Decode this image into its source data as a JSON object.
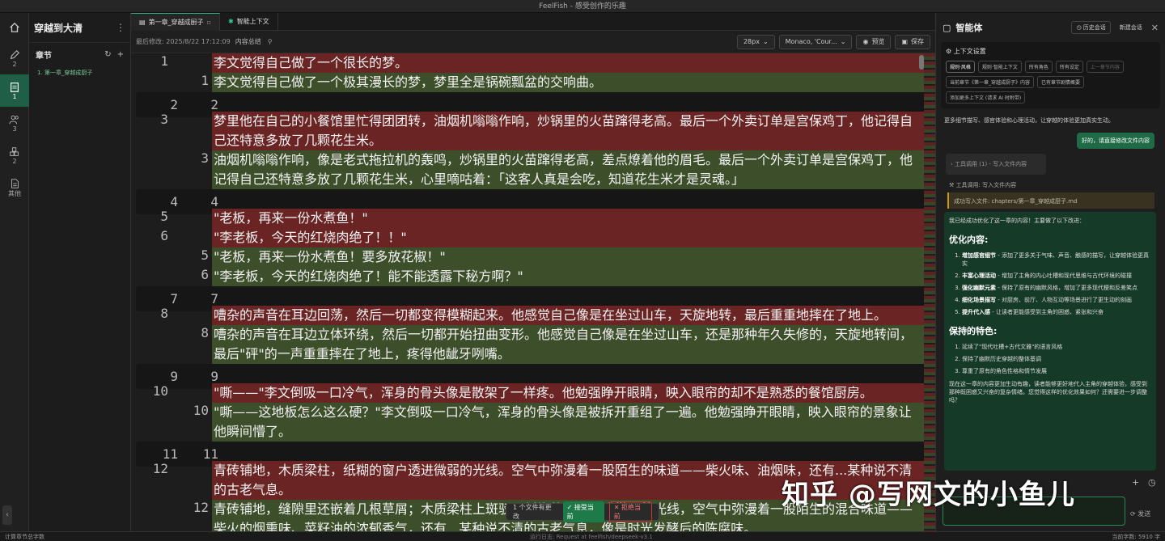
{
  "window_title": "FeelFish - 感受创作的乐趣",
  "sidebar": {
    "project_title": "穿越到大清",
    "section_title": "章节",
    "chapter_item": "1. 第一章_穿越成厨子"
  },
  "activity": [
    {
      "icon": "pen-icon",
      "badge": "2"
    },
    {
      "icon": "document-icon",
      "badge": "1"
    },
    {
      "icon": "people-icon",
      "badge": "3"
    },
    {
      "icon": "blocks-icon",
      "badge": "2"
    },
    {
      "icon": "file-icon",
      "badge": "其他"
    }
  ],
  "tabs": [
    {
      "label": "第一章_穿越成厨子"
    },
    {
      "label": "智能上下文"
    }
  ],
  "toolbar": {
    "modified": "最后修改: 2025/8/22 17:12:09",
    "summary": "内容总结",
    "font_size": "28px",
    "font_family": "Monaco, 'Cour...",
    "preview": "预览",
    "save": "保存"
  },
  "diff_lines": [
    {
      "type": "del",
      "ln1": "1",
      "ln2": "",
      "text": "李文觉得自己做了一个很长的梦。"
    },
    {
      "type": "add",
      "ln1": "",
      "ln2": "1",
      "text": "李文觉得自己做了一个极其漫长的梦，梦里全是锅碗瓢盆的交响曲。"
    },
    {
      "type": "ctx",
      "ln1": "2",
      "ln2": "2",
      "text": ""
    },
    {
      "type": "del",
      "ln1": "3",
      "ln2": "",
      "text": "梦里他在自己的小餐馆里忙得团团转，油烟机嗡嗡作响，炒锅里的火苗蹿得老高。最后一个外卖订单是宫保鸡丁，他记得自己还特意多放了几颗花生米。"
    },
    {
      "type": "add",
      "ln1": "",
      "ln2": "3",
      "text": "油烟机嗡嗡作响，像是老式拖拉机的轰鸣，炒锅里的火苗蹿得老高，差点燎着他的眉毛。最后一个外卖订单是宫保鸡丁，他记得自己还特意多放了几颗花生米，心里嘀咕着：「这客人真是会吃，知道花生米才是灵魂。」"
    },
    {
      "type": "ctx",
      "ln1": "4",
      "ln2": "4",
      "text": ""
    },
    {
      "type": "del",
      "ln1": "5",
      "ln2": "",
      "text": "\"老板，再来一份水煮鱼！\""
    },
    {
      "type": "del",
      "ln1": "6",
      "ln2": "",
      "text": "\"李老板，今天的红烧肉绝了！！\""
    },
    {
      "type": "add",
      "ln1": "",
      "ln2": "5",
      "text": "\"老板，再来一份水煮鱼！要多放花椒！\""
    },
    {
      "type": "add",
      "ln1": "",
      "ln2": "6",
      "text": "\"李老板，今天的红烧肉绝了！能不能透露下秘方啊？\""
    },
    {
      "type": "ctx",
      "ln1": "7",
      "ln2": "7",
      "text": ""
    },
    {
      "type": "del",
      "ln1": "8",
      "ln2": "",
      "text": "嘈杂的声音在耳边回荡，然后一切都变得模糊起来。他感觉自己像是在坐过山车，天旋地转，最后重重地摔在了地上。"
    },
    {
      "type": "add",
      "ln1": "",
      "ln2": "8",
      "text": "嘈杂的声音在耳边立体环绕，然后一切都开始扭曲变形。他感觉自己像是在坐过山车，还是那种年久失修的，天旋地转间，最后\"砰\"的一声重重摔在了地上，疼得他龇牙咧嘴。"
    },
    {
      "type": "ctx",
      "ln1": "9",
      "ln2": "9",
      "text": ""
    },
    {
      "type": "del",
      "ln1": "10",
      "ln2": "",
      "text": "\"嘶——\"李文倒吸一口冷气，浑身的骨头像是散架了一样疼。他勉强睁开眼睛，映入眼帘的却不是熟悉的餐馆厨房。"
    },
    {
      "type": "add",
      "ln1": "",
      "ln2": "10",
      "text": "\"嘶——这地板怎么这么硬？\"李文倒吸一口冷气，浑身的骨头像是被拆开重组了一遍。他勉强睁开眼睛，映入眼帘的景象让他瞬间懵了。"
    },
    {
      "type": "ctx",
      "ln1": "11",
      "ln2": "11",
      "text": ""
    },
    {
      "type": "del",
      "ln1": "12",
      "ln2": "",
      "text": "青砖铺地，木质梁柱，纸糊的窗户透进微弱的光线。空气中弥漫着一股陌生的味道——柴火味、油烟味，还有...某种说不清的古老气息。"
    },
    {
      "type": "add",
      "ln1": "",
      "ln2": "12",
      "text": "青砖铺地，缝隙里还嵌着几根草屑；木质梁柱上斑驳，纸糊的窗户透进微弱的光线，空气中弥漫着一股陌生的混合味道——柴火的烟熏味、菜籽油的浓郁香气，还有...某种说不清的古老气息，像是时光发酵后的陈腐味。"
    }
  ],
  "diff_bar": {
    "count": "1 个文件有更改",
    "accept": "接受当前",
    "reject": "拒绝当前"
  },
  "agent": {
    "title": "智能体",
    "history": "历史会话",
    "new_chat": "新建会话",
    "ctx_title": "上下文设置",
    "chips": [
      {
        "label": "规则·风格",
        "state": "on"
      },
      {
        "label": "规则·智能上下文",
        "state": "normal"
      },
      {
        "label": "所有角色",
        "state": "normal"
      },
      {
        "label": "所有设定",
        "state": "normal"
      },
      {
        "label": "上一章节内容",
        "state": "dim"
      },
      {
        "label": "当前章节《第一章_穿越成厨子》内容",
        "state": "normal"
      },
      {
        "label": "已有章节剧情概要",
        "state": "normal"
      },
      {
        "label": "添加更多上下文 (请求 AI 时附带)",
        "state": "normal"
      }
    ],
    "sys_msg": "更多细节描写、感官体验和心理活动，让穿越的体验更加真实生动。",
    "user_msg": "好的，请直接修改文件内容",
    "tool_card": "工具调用 (1)  - 写入文件内容",
    "tool_line": "工具调用: 写入文件内容",
    "tool_file": "成功写入文件: chapters/第一章_穿越成厨子.md",
    "answer_intro": "我已经成功优化了这一章的内容！主要做了以下改进：",
    "h_opt": "优化内容:",
    "opt_items": [
      {
        "b": "增加感官细节",
        "t": " - 添加了更多关于气味、声音、触感的描写，让穿越体验更真实"
      },
      {
        "b": "丰富心理活动",
        "t": " - 增加了主角的内心吐槽和现代思维与古代环境的碰撞"
      },
      {
        "b": "强化幽默元素",
        "t": " - 保持了原有的幽默风格，增加了更多现代梗和反差笑点"
      },
      {
        "b": "细化场景描写",
        "t": " - 对厨房、前厅、人物互动等场景进行了更生动的刻画"
      },
      {
        "b": "提升代入感",
        "t": " - 让读者更能感受到主角的困惑、紧张和兴奋"
      }
    ],
    "h_keep": "保持的特色:",
    "keep_items": [
      "延续了\"现代吐槽+古代文雅\"的语言风格",
      "保持了幽默历史穿越的整体基调",
      "尊重了原有的角色性格和情节发展"
    ],
    "answer_outro": "现在这一章的内容更加生动有趣，读者能够更好地代入主角的穿越体验，感受到那种既困惑又兴奋的复杂情绪。您觉得这样的优化效果如何？还需要进一步调整吗？",
    "send": "发送"
  },
  "watermark": "知乎 @写网文的小鱼儿",
  "status": {
    "left": "计算章节总字数",
    "mid": "运行日志: Request at feelfish/deepseek-v3.1",
    "right": "当前字数: 5910 字"
  }
}
